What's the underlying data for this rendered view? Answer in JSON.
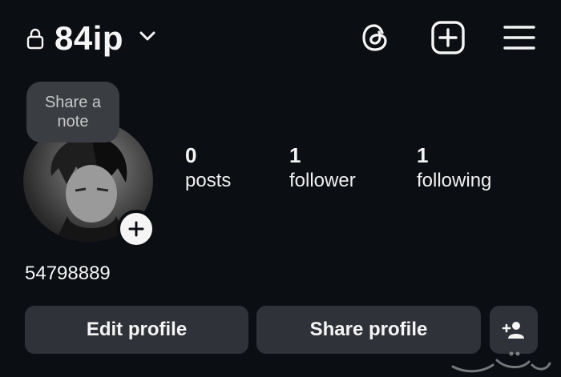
{
  "header": {
    "username": "84ip",
    "icons": {
      "lock": "lock-icon",
      "chevron": "chevron-down-icon",
      "threads": "threads-icon",
      "create": "plus-square-icon",
      "menu": "hamburger-menu-icon"
    }
  },
  "profile": {
    "note_prompt": "Share a note",
    "display_name": "54798889"
  },
  "stats": [
    {
      "count": "0",
      "label": "posts"
    },
    {
      "count": "1",
      "label": "follower"
    },
    {
      "count": "1",
      "label": "following"
    }
  ],
  "actions": {
    "edit_label": "Edit profile",
    "share_label": "Share profile",
    "add_icon": "add-person-icon"
  },
  "watermark": {
    "brand": "haraj-logo"
  },
  "colors": {
    "background": "#0b0e13",
    "button_bg": "#2f3238",
    "note_bg": "#3a3d42",
    "text": "#f5f5f5"
  }
}
